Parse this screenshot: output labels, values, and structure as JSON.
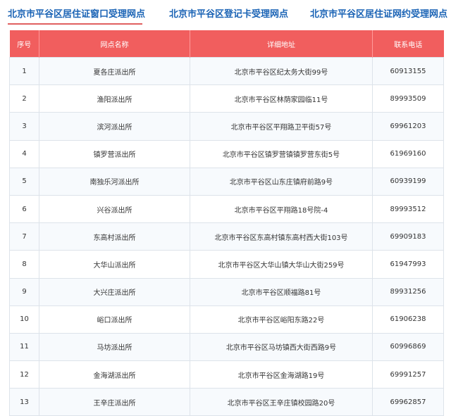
{
  "tabs": [
    {
      "label": "北京市平谷区居住证窗口受理网点",
      "active": true
    },
    {
      "label": "北京市平谷区登记卡受理网点",
      "active": false
    },
    {
      "label": "北京市平谷区居住证网约受理网点",
      "active": false
    }
  ],
  "colors": {
    "tab_text": "#1a63b5",
    "header_bg": "#f15e5e",
    "active_underline": "#e06060"
  },
  "table": {
    "headers": [
      "序号",
      "网点名称",
      "详细地址",
      "联系电话"
    ],
    "rows": [
      [
        "1",
        "夏各庄派出所",
        "北京市平谷区纪太务大街99号",
        "60913155"
      ],
      [
        "2",
        "渔阳派出所",
        "北京市平谷区林荫家园临11号",
        "89993509"
      ],
      [
        "3",
        "滨河派出所",
        "北京市平谷区平翔路卫平街57号",
        "69961203"
      ],
      [
        "4",
        "镇罗营派出所",
        "北京市平谷区镇罗营镇镇罗营东街5号",
        "61969160"
      ],
      [
        "5",
        "南独乐河派出所",
        "北京市平谷区山东庄镇府前路9号",
        "60939199"
      ],
      [
        "6",
        "兴谷派出所",
        "北京市平谷区平翔路18号院-4",
        "89993512"
      ],
      [
        "7",
        "东高村派出所",
        "北京市平谷区东高村镇东高村西大街103号",
        "69909183"
      ],
      [
        "8",
        "大华山派出所",
        "北京市平谷区大华山镇大华山大街259号",
        "61947993"
      ],
      [
        "9",
        "大兴庄派出所",
        "北京市平谷区顺福路81号",
        "89931256"
      ],
      [
        "10",
        "峪口派出所",
        "北京市平谷区峪阳东路22号",
        "61906238"
      ],
      [
        "11",
        "马坊派出所",
        "北京市平谷区马坊镇西大街西路9号",
        "60996869"
      ],
      [
        "12",
        "金海湖派出所",
        "北京市平谷区金海湖路19号",
        "69991257"
      ],
      [
        "13",
        "王辛庄派出所",
        "北京市平谷区王辛庄镇校园路20号",
        "69962857"
      ]
    ]
  }
}
